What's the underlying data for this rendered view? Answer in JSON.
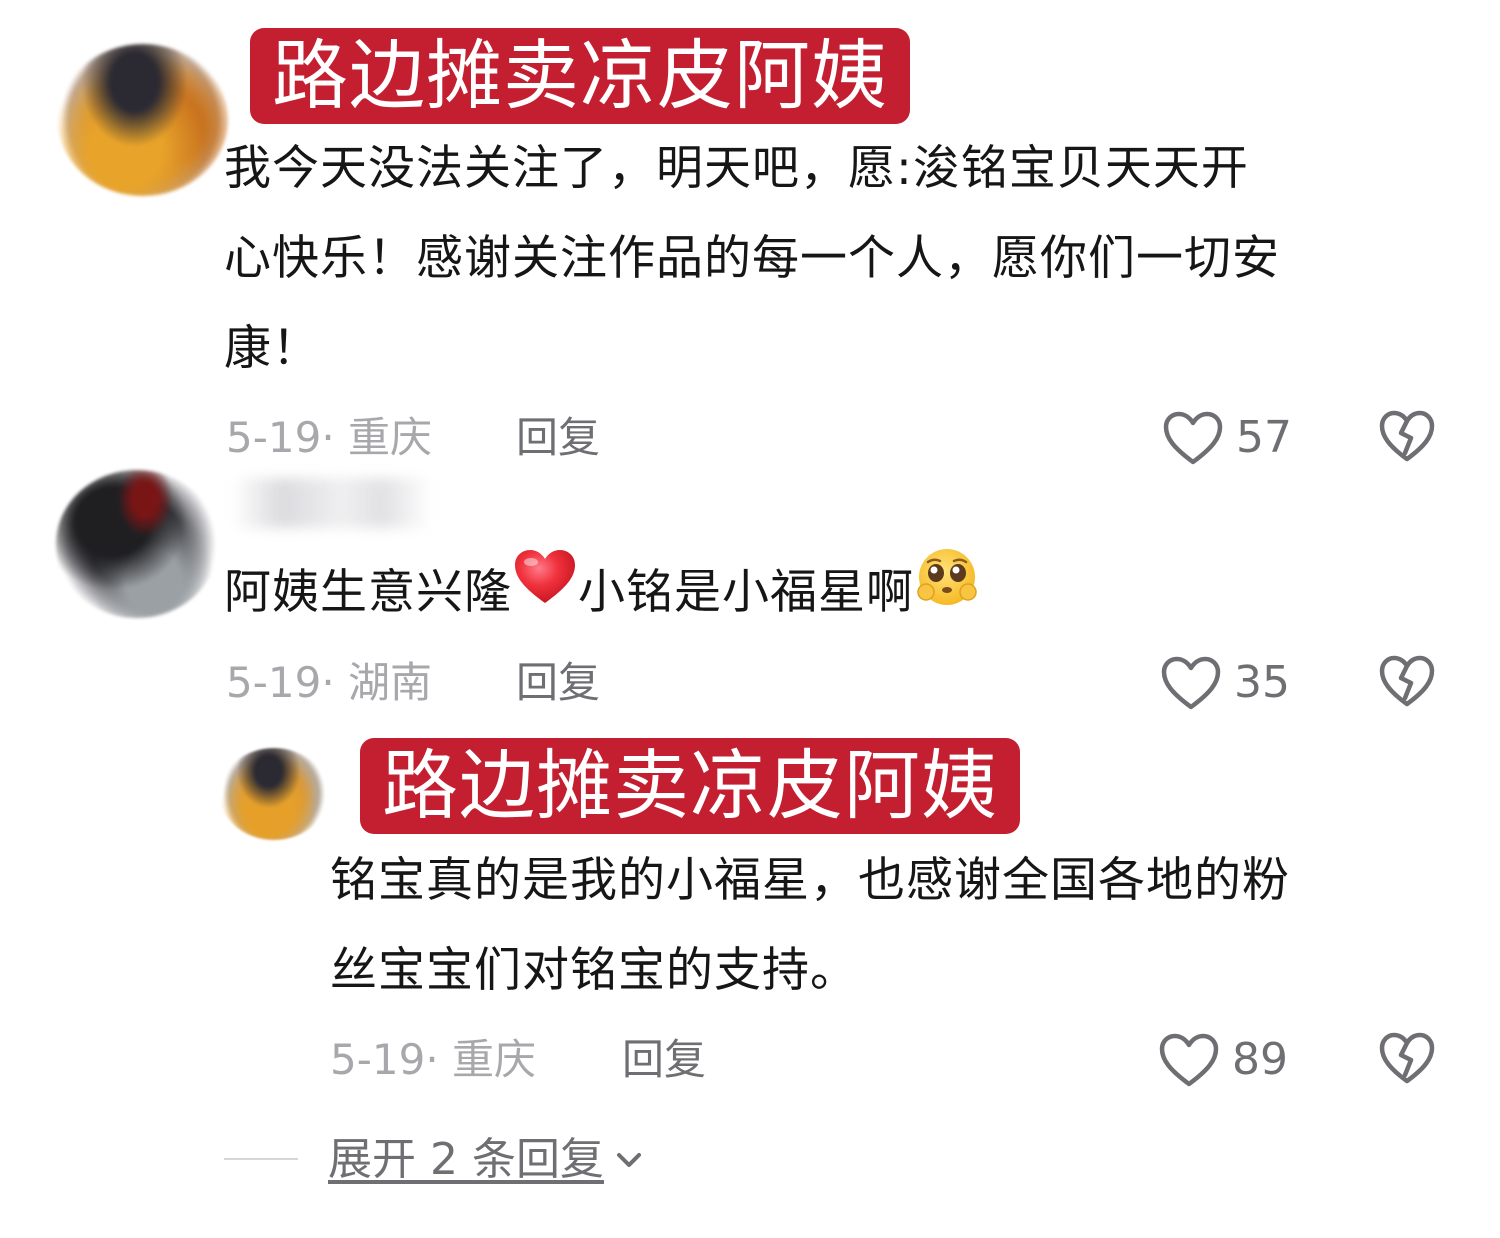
{
  "comments": [
    {
      "username": "路边摊卖凉皮阿姨",
      "text": "我今天没法关注了，明天吧，愿:浚铭宝贝天天开心快乐！感谢关注作品的每一个人，愿你们一切安康！",
      "lines": [
        "我今天没法关注了，明天吧，愿:浚铭宝贝天天开",
        "心快乐！感谢关注作品的每一个人，愿你们一切安",
        "康！"
      ],
      "meta": "5-19· 重庆",
      "reply_label": "回复",
      "likes": "57"
    },
    {
      "username": "",
      "text_parts": [
        "阿姨生意兴隆",
        "小铭是小福星啊"
      ],
      "emoji": [
        "red-heart",
        "pleading-face"
      ],
      "meta": "5-19· 湖南",
      "reply_label": "回复",
      "likes": "35"
    }
  ],
  "reply": {
    "username": "路边摊卖凉皮阿姨",
    "lines": [
      "铭宝真的是我的小福星，也感谢全国各地的粉",
      "丝宝宝们对铭宝的支持。"
    ],
    "meta": "5-19· 重庆",
    "reply_label": "回复",
    "likes": "89"
  },
  "expand_label": "展开 2 条回复",
  "colors": {
    "banner": "#c41e31",
    "meta_text": "#a8a8ac",
    "action_text": "#6e6e73"
  }
}
